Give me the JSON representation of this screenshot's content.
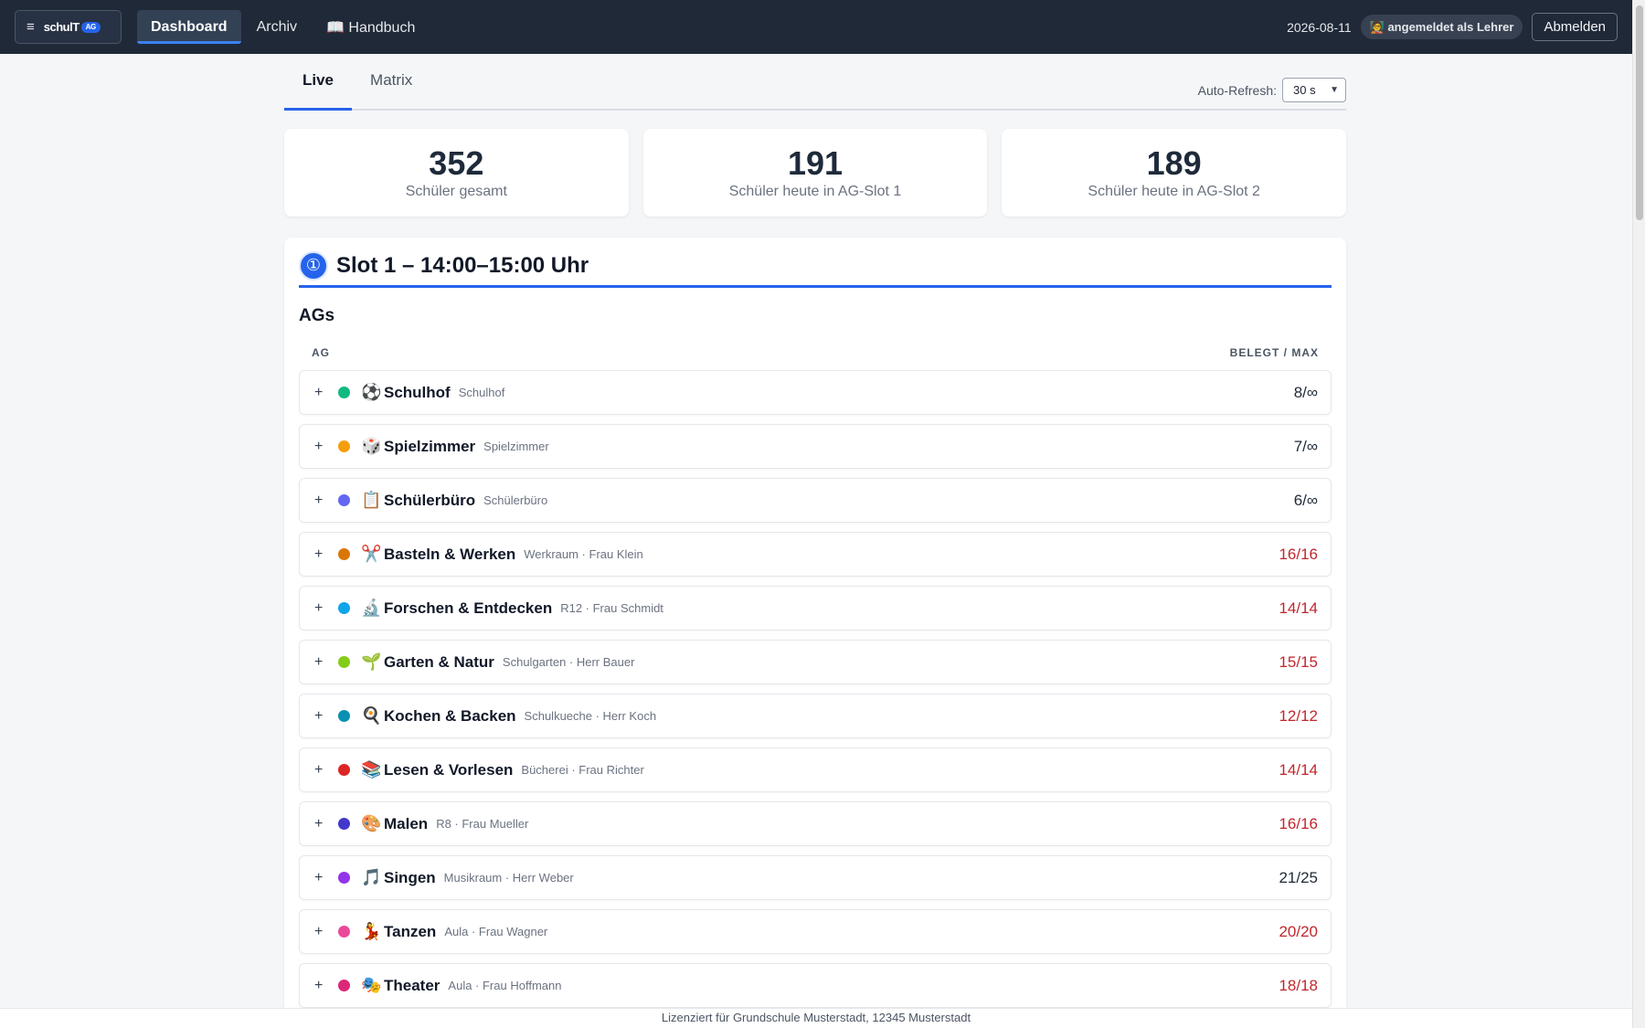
{
  "header": {
    "menu_icon": "hamburger-icon",
    "brand_text": "schulT",
    "brand_badge": "AG",
    "nav": [
      {
        "label": "Dashboard"
      },
      {
        "label": "Archiv"
      },
      {
        "label": "📖 Handbuch"
      }
    ],
    "date": "2026-08-11",
    "user_status": "🧑‍🏫 angemeldet als Lehrer",
    "logout_label": "Abmelden"
  },
  "tabs": [
    {
      "label": "Live"
    },
    {
      "label": "Matrix"
    }
  ],
  "refresh": {
    "label": "Auto-Refresh:",
    "value": "30 s"
  },
  "stats": [
    {
      "value": "352",
      "label": "Schüler gesamt"
    },
    {
      "value": "191",
      "label": "Schüler heute in AG-Slot 1"
    },
    {
      "value": "189",
      "label": "Schüler heute in AG-Slot 2"
    }
  ],
  "slot": {
    "badge": "①",
    "title": "Slot 1 – 14:00–15:00 Uhr",
    "section_title": "AGs",
    "col_ag": "AG",
    "col_count": "BELEGT / MAX",
    "rows": [
      {
        "icon": "⚽",
        "name": "Schulhof",
        "sub": "Schulhof",
        "count": "8/∞",
        "color": "#10b981",
        "full": false
      },
      {
        "icon": "🎲",
        "name": "Spielzimmer",
        "sub": "Spielzimmer",
        "count": "7/∞",
        "color": "#f59e0b",
        "full": false
      },
      {
        "icon": "📋",
        "name": "Schülerbüro",
        "sub": "Schülerbüro",
        "count": "6/∞",
        "color": "#6366f1",
        "full": false
      },
      {
        "icon": "✂️",
        "name": "Basteln & Werken",
        "sub": "Werkraum · Frau Klein",
        "count": "16/16",
        "color": "#d97706",
        "full": true
      },
      {
        "icon": "🔬",
        "name": "Forschen & Entdecken",
        "sub": "R12 · Frau Schmidt",
        "count": "14/14",
        "color": "#0ea5e9",
        "full": true
      },
      {
        "icon": "🌱",
        "name": "Garten & Natur",
        "sub": "Schulgarten · Herr Bauer",
        "count": "15/15",
        "color": "#84cc16",
        "full": true
      },
      {
        "icon": "🍳",
        "name": "Kochen & Backen",
        "sub": "Schulkueche · Herr Koch",
        "count": "12/12",
        "color": "#0891b2",
        "full": true
      },
      {
        "icon": "📚",
        "name": "Lesen & Vorlesen",
        "sub": "Bücherei · Frau Richter",
        "count": "14/14",
        "color": "#dc2626",
        "full": true
      },
      {
        "icon": "🎨",
        "name": "Malen",
        "sub": "R8 · Frau Mueller",
        "count": "16/16",
        "color": "#4338ca",
        "full": true
      },
      {
        "icon": "🎵",
        "name": "Singen",
        "sub": "Musikraum · Herr Weber",
        "count": "21/25",
        "color": "#9333ea",
        "full": false
      },
      {
        "icon": "💃",
        "name": "Tanzen",
        "sub": "Aula · Frau Wagner",
        "count": "20/20",
        "color": "#ec4899",
        "full": true
      },
      {
        "icon": "🎭",
        "name": "Theater",
        "sub": "Aula · Frau Hoffmann",
        "count": "18/18",
        "color": "#db2777",
        "full": true
      }
    ]
  },
  "footer": {
    "text": "Lizenziert für Grundschule Musterstadt, 12345 Musterstadt"
  },
  "colors": {
    "accent": "#2563eb",
    "full": "#c0262d",
    "topbar": "#1f2937"
  }
}
